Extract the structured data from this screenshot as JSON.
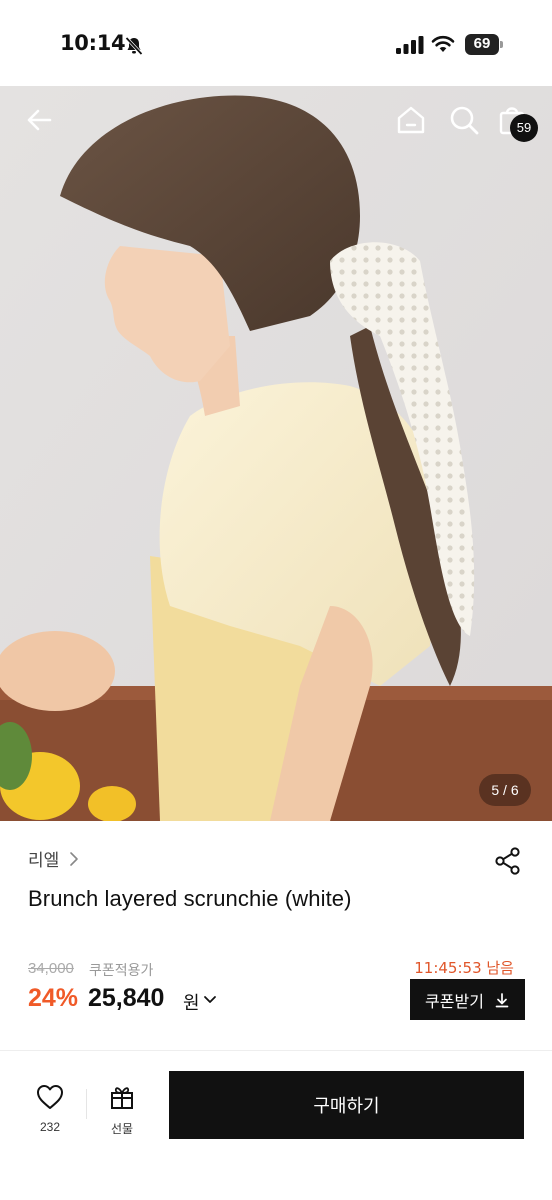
{
  "status_bar": {
    "time": "10:14",
    "battery_percent": "69",
    "icons": [
      "bell-off-icon",
      "cellular-signal-icon",
      "wifi-icon",
      "battery-icon"
    ]
  },
  "header": {
    "icons": [
      "back-arrow-icon",
      "home-icon",
      "search-icon",
      "shopping-bag-icon"
    ],
    "cart_count": "59"
  },
  "gallery": {
    "counter": "5 / 6",
    "current_image": 5,
    "total_images": 6
  },
  "product": {
    "brand": "리엘",
    "title": "Brunch layered scrunchie (white)",
    "original_price": "34,000",
    "coupon_note": "쿠폰적용가",
    "timer": "11:45:53 남음",
    "discount_rate": "24%",
    "sale_price": "25,840",
    "currency": "원",
    "coupon_button_label": "쿠폰받기"
  },
  "action_bar": {
    "like_count": "232",
    "gift_label": "선물",
    "buy_label": "구매하기"
  },
  "colors": {
    "accent_discount": "#f05a28",
    "timer": "#e0562a",
    "primary_button": "#111111"
  }
}
